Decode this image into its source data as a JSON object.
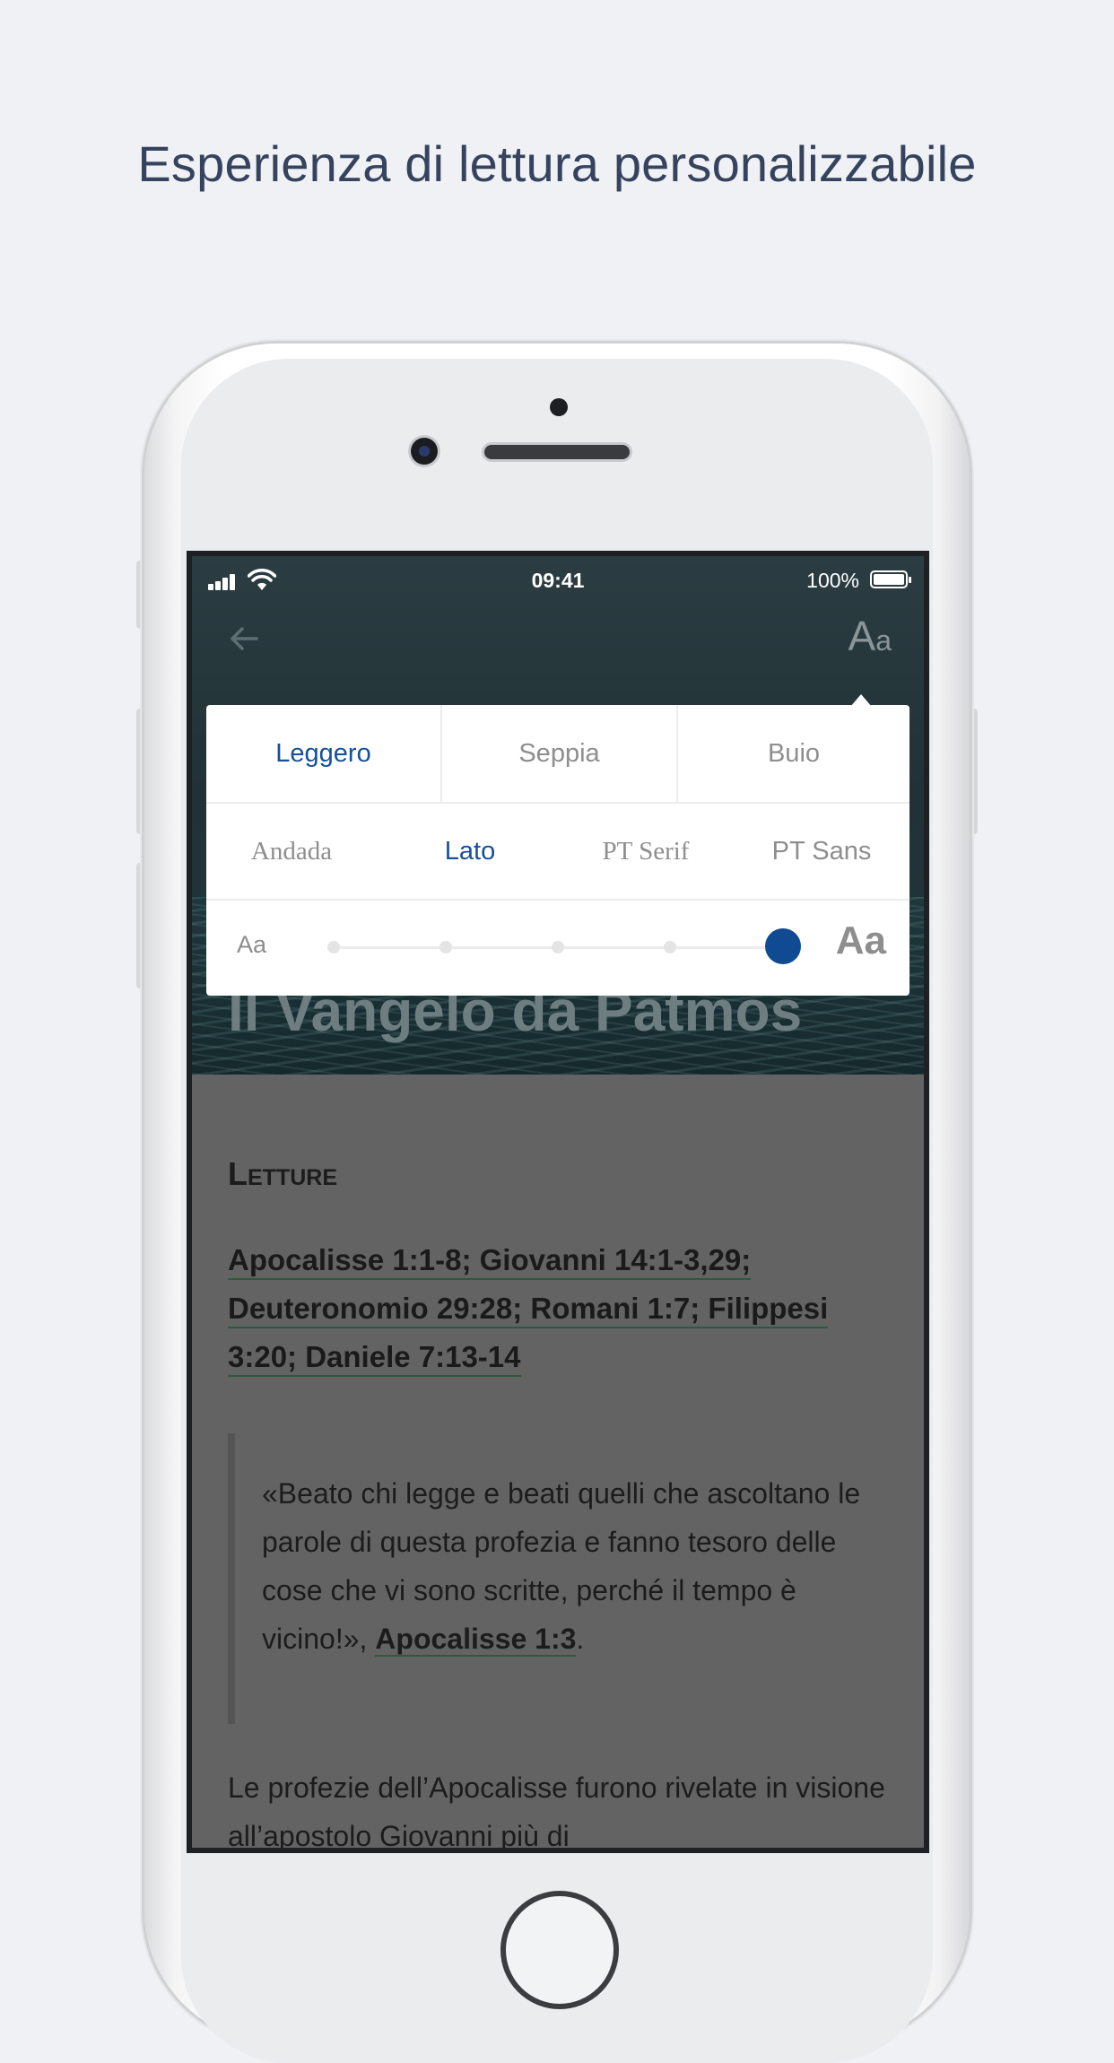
{
  "headline": "Esperienza di lettura personalizzabile",
  "status_bar": {
    "time": "09:41",
    "battery": "100%"
  },
  "icons": {
    "back": "arrow-left-icon",
    "font_settings": "text-size-icon",
    "signal": "cellular-signal-icon",
    "wifi": "wifi-icon",
    "battery": "battery-icon"
  },
  "toolbar": {
    "font_toggle_big": "A",
    "font_toggle_small": "a"
  },
  "settings": {
    "themes": [
      "Leggero",
      "Seppia",
      "Buio"
    ],
    "active_theme": "Leggero",
    "fonts": [
      "Andada",
      "Lato",
      "PT Serif",
      "PT Sans"
    ],
    "active_font": "Lato",
    "size_small_label": "Aa",
    "size_large_label": "Aa",
    "size_steps": 5,
    "size_value": 5
  },
  "article": {
    "title": "Il Vangelo da Patmos",
    "section_heading": "Letture",
    "references": "Apocalisse 1:1-8; Giovanni 14:1-3,29; Deuteronomio 29:28; Romani 1:7; Filippesi 3:20; Daniele 7:13-14",
    "quote_text": "«Beato chi legge e beati quelli che ascoltano le parole di questa profezia e fanno tesoro delle cose che vi sono scritte, perché il tempo è vicino!»,",
    "quote_ref": "Apocalisse 1:3",
    "quote_end": ".",
    "paragraph": "Le profezie dell’Apocalisse furono rivelate in visione all’apostolo Giovanni più di"
  },
  "colors": {
    "accent": "#16509a",
    "slider_thumb": "#0f4a93",
    "background": "#eff1f4"
  }
}
